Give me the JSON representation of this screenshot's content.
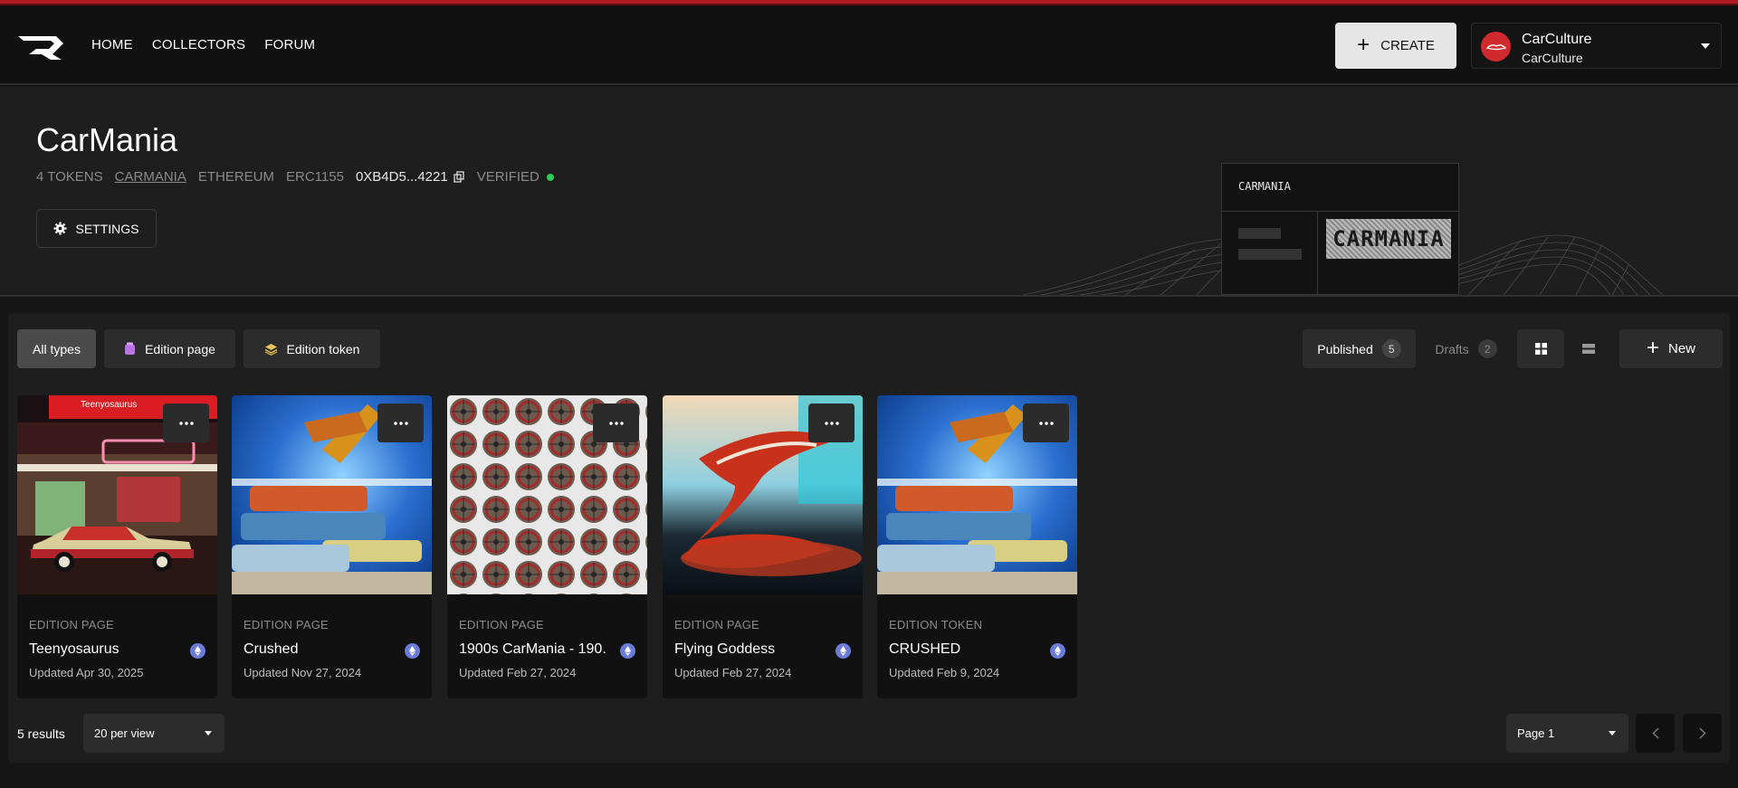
{
  "nav": {
    "items": [
      "HOME",
      "COLLECTORS",
      "FORUM"
    ]
  },
  "header": {
    "create_label": "CREATE",
    "account": {
      "name": "CarCulture",
      "handle": "CarCulture"
    }
  },
  "collection": {
    "title": "CarMania",
    "tokens": "4 TOKENS",
    "symbol": "CARMANIA",
    "chain": "ETHEREUM",
    "standard": "ERC1155",
    "address": "0XB4D5...4221",
    "verified": "VERIFIED",
    "settings_label": "SETTINGS",
    "card_title": "CARMANIA",
    "card_logo_text": "CARMANIA"
  },
  "filters": {
    "all": "All types",
    "page": "Edition page",
    "token": "Edition token"
  },
  "status": {
    "published": "Published",
    "published_count": "5",
    "drafts": "Drafts",
    "drafts_count": "2"
  },
  "new_label": "New",
  "cards": [
    {
      "type": "EDITION PAGE",
      "title": "Teenyosaurus",
      "updated": "Updated Apr 30, 2025",
      "banner": "Teenyosaurus"
    },
    {
      "type": "EDITION PAGE",
      "title": "Crushed",
      "updated": "Updated Nov 27, 2024"
    },
    {
      "type": "EDITION PAGE",
      "title": "1900s CarMania - 190...",
      "updated": "Updated Feb 27, 2024"
    },
    {
      "type": "EDITION PAGE",
      "title": "Flying Goddess",
      "updated": "Updated Feb 27, 2024"
    },
    {
      "type": "EDITION TOKEN",
      "title": "CRUSHED",
      "updated": "Updated Feb 9, 2024"
    }
  ],
  "footer": {
    "results": "5 results",
    "per_view": "20 per view",
    "page": "Page 1"
  },
  "colors": {
    "accent_red": "#b01c22",
    "verified": "#2ecc58",
    "eth": "#6c7bd8"
  }
}
